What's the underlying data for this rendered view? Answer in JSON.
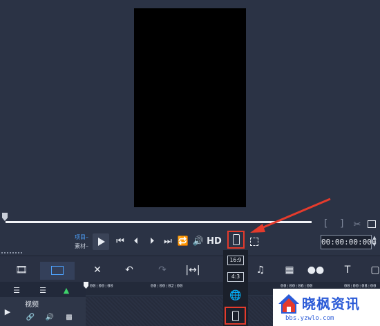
{
  "preview": {
    "label_project": "项目",
    "label_clip": "素材",
    "hd_label": "HD",
    "timecode": "00:00:00:000",
    "bracket_in": "[",
    "bracket_out": "]"
  },
  "aspect_menu": {
    "items": [
      "16:9",
      "4:3"
    ]
  },
  "timeline": {
    "ruler_labels": [
      "00:00:00",
      "00:00:02:00",
      "00:00:06:00",
      "00:00:08:00"
    ],
    "track_name": "视频"
  },
  "watermark": {
    "title": "晓枫资讯",
    "url": "bbs.yzwlo.com"
  },
  "colors": {
    "background": "#2b3345",
    "highlight": "#e53b2c",
    "accent": "#4ea3ff"
  }
}
